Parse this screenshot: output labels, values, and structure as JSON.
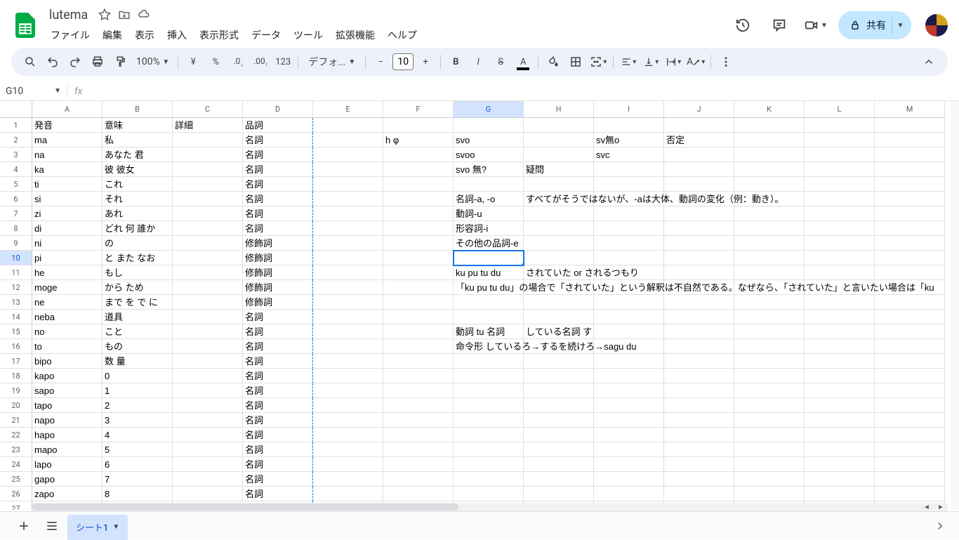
{
  "doc": {
    "title": "lutema"
  },
  "menu": [
    "ファイル",
    "編集",
    "表示",
    "挿入",
    "表示形式",
    "データ",
    "ツール",
    "拡張機能",
    "ヘルプ"
  ],
  "share": {
    "label": "共有"
  },
  "toolbar": {
    "zoom": "100%",
    "font": "デフォ...",
    "fontSize": "10",
    "numfmt": "123"
  },
  "nameBox": "G10",
  "columns": [
    "A",
    "B",
    "C",
    "D",
    "E",
    "F",
    "G",
    "H",
    "I",
    "J",
    "K",
    "L",
    "M"
  ],
  "activeColIndex": 6,
  "activeRowIndex": 9,
  "rows": [
    {
      "A": "発音",
      "B": "意味",
      "C": "詳細",
      "D": "品詞"
    },
    {
      "A": "ma",
      "B": "私",
      "D": "名詞",
      "F": "h φ",
      "G": "svo",
      "I": "sv無o",
      "J": "否定"
    },
    {
      "A": "na",
      "B": "あなた 君",
      "D": "名詞",
      "G": "svoo",
      "I": "svc"
    },
    {
      "A": "ka",
      "B": "彼 彼女",
      "D": "名詞",
      "G": "svo 無?",
      "H": "疑問"
    },
    {
      "A": "ti",
      "B": "これ",
      "D": "名詞"
    },
    {
      "A": "si",
      "B": "それ",
      "D": "名詞",
      "G": "名詞-a, -o",
      "H": "すべてがそうではないが、-aは大体、動詞の変化（例：動き）。"
    },
    {
      "A": "zi",
      "B": "あれ",
      "D": "名詞",
      "G": "動詞-u"
    },
    {
      "A": "di",
      "B": "どれ 何 誰か",
      "D": "名詞",
      "G": "形容詞-i"
    },
    {
      "A": "ni",
      "B": "の",
      "D": "修飾詞",
      "G": "その他の品詞-e"
    },
    {
      "A": "pi",
      "B": "と また なお",
      "D": "修飾詞"
    },
    {
      "A": "he",
      "B": "もし",
      "D": "修飾詞",
      "G": "ku pu tu du",
      "H": "されていた or されるつもり"
    },
    {
      "A": "moge",
      "B": "から ため",
      "D": "修飾詞",
      "G": "「ku pu tu du」の場合で「されていた」という解釈は不自然である。なぜなら、「されていた」と言いたい場合は「ku"
    },
    {
      "A": "ne",
      "B": "まで を で に",
      "D": "修飾詞"
    },
    {
      "A": "neba",
      "B": "道具",
      "D": "名詞"
    },
    {
      "A": "no",
      "B": "こと",
      "D": "名詞",
      "G": "動詞 tu 名詞",
      "H": "している名詞 する名詞"
    },
    {
      "A": "to",
      "B": "もの",
      "D": "名詞",
      "G": "命令形 しているろ→するを続けろ→sagu du"
    },
    {
      "A": "bipo",
      "B": "数 量",
      "D": "名詞"
    },
    {
      "A": "kapo",
      "B": "0",
      "D": "名詞"
    },
    {
      "A": "sapo",
      "B": "1",
      "D": "名詞"
    },
    {
      "A": "tapo",
      "B": "2",
      "D": "名詞"
    },
    {
      "A": "napo",
      "B": "3",
      "D": "名詞"
    },
    {
      "A": "hapo",
      "B": "4",
      "D": "名詞"
    },
    {
      "A": "mapo",
      "B": "5",
      "D": "名詞"
    },
    {
      "A": "lapo",
      "B": "6",
      "D": "名詞"
    },
    {
      "A": "gapo",
      "B": "7",
      "D": "名詞"
    },
    {
      "A": "zapo",
      "B": "8",
      "D": "名詞"
    },
    {
      "A": "",
      "D": ""
    }
  ],
  "sheet": {
    "name": "シート1"
  }
}
